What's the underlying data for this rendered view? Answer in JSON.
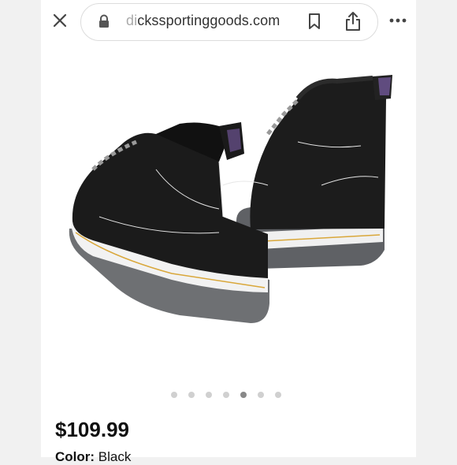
{
  "browser": {
    "url_prefix": "di",
    "url_rest": "ckssportinggoods.com"
  },
  "product": {
    "price": "$109.99",
    "color_label": "Color:",
    "color_value": "Black"
  },
  "carousel": {
    "dot_count": 7,
    "active_index": 4
  },
  "colors": {
    "boot_black": "#1b1b1b",
    "sole_gray": "#6e7073",
    "welt_white": "#f2f2f2",
    "stitch_yellow": "#d9a73a"
  }
}
